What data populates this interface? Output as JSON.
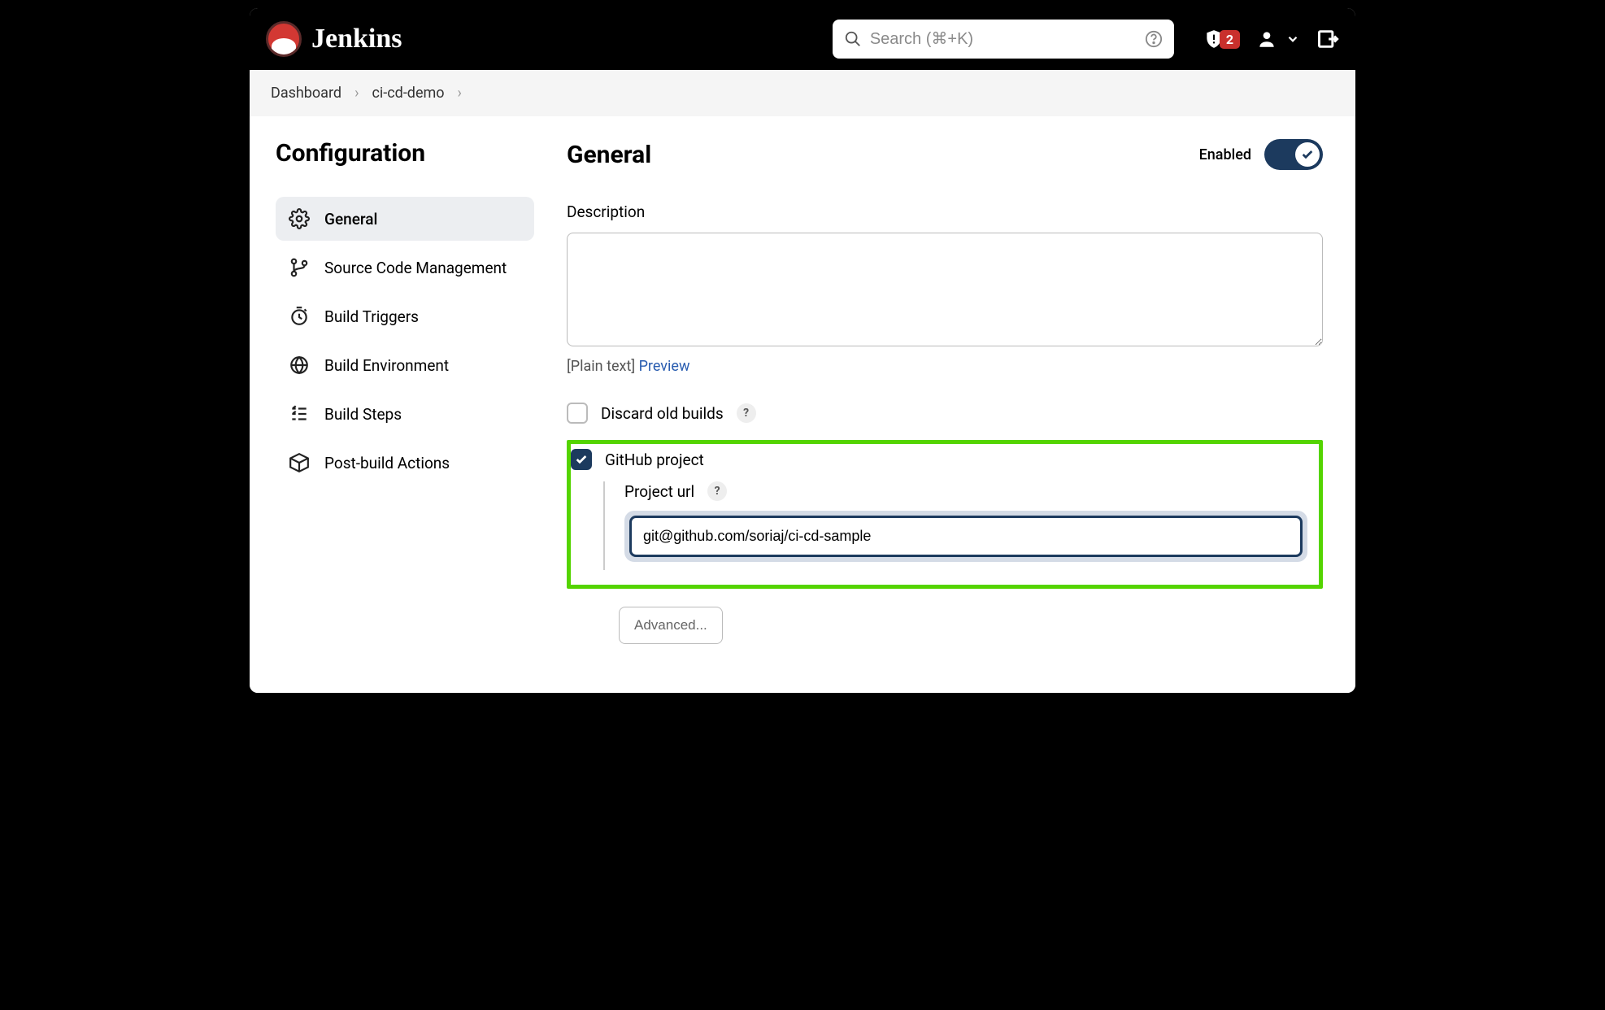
{
  "header": {
    "brand": "Jenkins",
    "search_placeholder": "Search (⌘+K)",
    "notification_count": "2"
  },
  "breadcrumbs": [
    "Dashboard",
    "ci-cd-demo"
  ],
  "sidebar": {
    "title": "Configuration",
    "items": [
      {
        "label": "General"
      },
      {
        "label": "Source Code Management"
      },
      {
        "label": "Build Triggers"
      },
      {
        "label": "Build Environment"
      },
      {
        "label": "Build Steps"
      },
      {
        "label": "Post-build Actions"
      }
    ]
  },
  "main": {
    "heading": "General",
    "enabled_label": "Enabled",
    "description_label": "Description",
    "description_value": "",
    "plain_text_hint": "[Plain text]",
    "preview_link": "Preview",
    "discard_label": "Discard old builds",
    "github_label": "GitHub project",
    "project_url_label": "Project url",
    "project_url_value": "git@github.com/soriaj/ci-cd-sample",
    "advanced_button": "Advanced..."
  }
}
